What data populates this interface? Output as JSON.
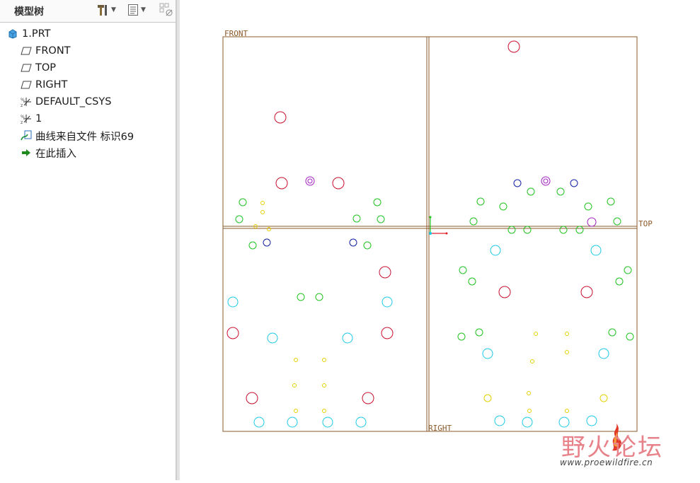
{
  "sidebar": {
    "title": "模型树",
    "icons": [
      "hammer-icon",
      "settings-list-icon",
      "show-hide-icon"
    ],
    "items": [
      {
        "label": "1.PRT",
        "icon": "part-icon"
      },
      {
        "label": "FRONT",
        "icon": "datum-plane-icon"
      },
      {
        "label": "TOP",
        "icon": "datum-plane-icon"
      },
      {
        "label": "RIGHT",
        "icon": "datum-plane-icon"
      },
      {
        "label": "DEFAULT_CSYS",
        "icon": "csys-icon"
      },
      {
        "label": "1",
        "icon": "csys-icon"
      },
      {
        "label": "曲线来自文件 标识69",
        "icon": "curve-from-file-icon"
      },
      {
        "label": "在此插入",
        "icon": "insert-here-arrow-icon"
      }
    ]
  },
  "viewport": {
    "plane_labels": {
      "front": "FRONT",
      "top": "TOP",
      "right": "RIGHT"
    },
    "colors": {
      "frame": "#8b5a2b",
      "red": "#c8102e",
      "green": "#22c322",
      "cyan": "#19c8e6",
      "yellow": "#e6d200",
      "blue": "#1020a0",
      "magenta": "#a020c0"
    }
  },
  "watermark": {
    "title": "野火论坛",
    "url": "www.proewildfire.cn"
  }
}
